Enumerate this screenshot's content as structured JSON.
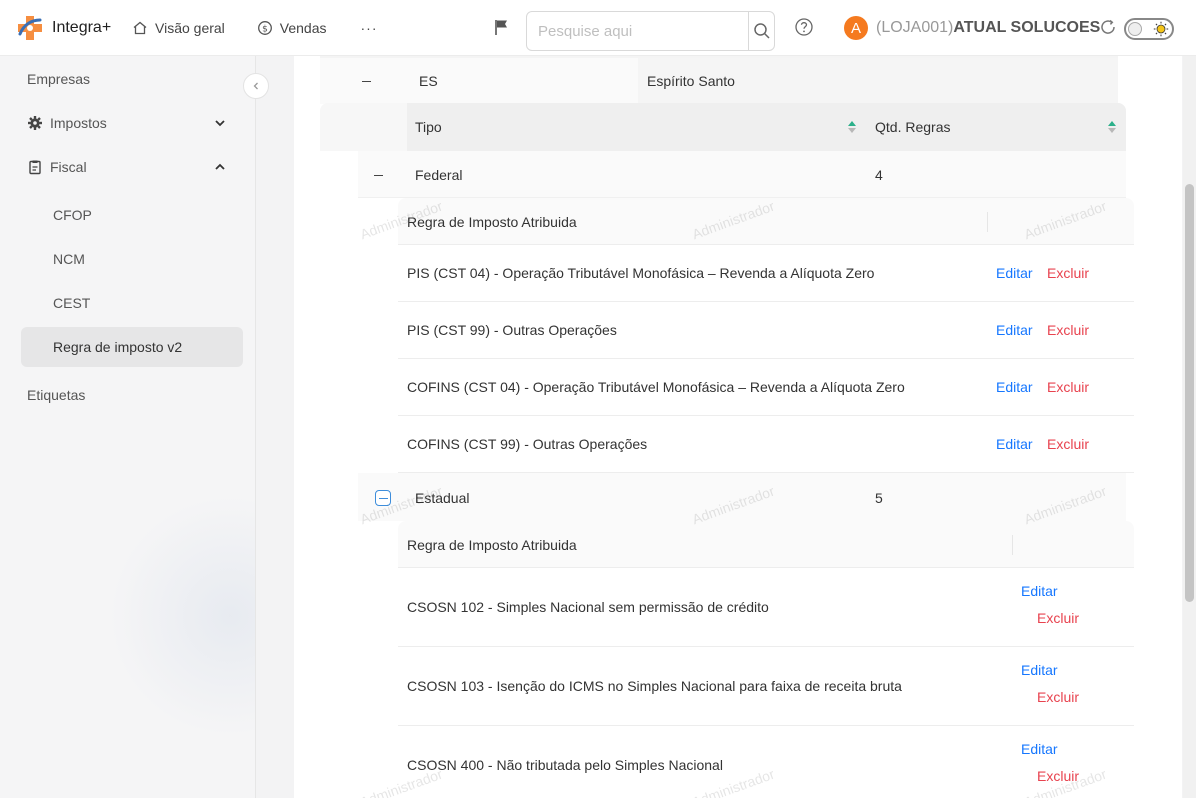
{
  "header": {
    "app_name": "Integra+",
    "nav": [
      {
        "label": "Visão geral",
        "icon": "home-icon"
      },
      {
        "label": "Vendas",
        "icon": "dollar-circle-icon"
      }
    ],
    "more": "···",
    "search_placeholder": "Pesquise aqui",
    "avatar_letter": "A",
    "store_code": "(LOJA001)",
    "store_name": "ATUAL SOLUCOES"
  },
  "sidebar": {
    "items": [
      {
        "label": "Empresas"
      },
      {
        "label": "Impostos"
      },
      {
        "label": "Fiscal"
      },
      {
        "label": "CFOP"
      },
      {
        "label": "NCM"
      },
      {
        "label": "CEST"
      },
      {
        "label": "Regra de imposto v2"
      },
      {
        "label": "Etiquetas"
      }
    ]
  },
  "state_row": {
    "code": "ES",
    "name": "Espírito Santo"
  },
  "type_table": {
    "headers": {
      "tipo": "Tipo",
      "qtd": "Qtd. Regras"
    },
    "groups": [
      {
        "tipo": "Federal",
        "qtd": "4",
        "rules_header": "Regra de Imposto Atribuida",
        "rules": [
          {
            "name": "PIS (CST 04) - Operação Tributável Monofásica – Revenda a Alíquota Zero"
          },
          {
            "name": "PIS (CST 99) - Outras Operações"
          },
          {
            "name": "COFINS (CST 04) - Operação Tributável Monofásica – Revenda a Alíquota Zero"
          },
          {
            "name": "COFINS (CST 99) - Outras Operações"
          }
        ]
      },
      {
        "tipo": "Estadual",
        "qtd": "5",
        "rules_header": "Regra de Imposto Atribuida",
        "rules": [
          {
            "name": "CSOSN 102 - Simples Nacional sem permissão de crédito"
          },
          {
            "name": "CSOSN 103 - Isenção do ICMS no Simples Nacional para faixa de receita bruta"
          },
          {
            "name": "CSOSN 400 - Não tributada pelo Simples Nacional"
          }
        ]
      }
    ]
  },
  "actions": {
    "edit": "Editar",
    "delete": "Excluir"
  },
  "watermark": "Administrador",
  "colors": {
    "accent": "#1677ff",
    "danger": "#e8434f",
    "avatar": "#f57a1f",
    "sort": "#2bb08a"
  }
}
